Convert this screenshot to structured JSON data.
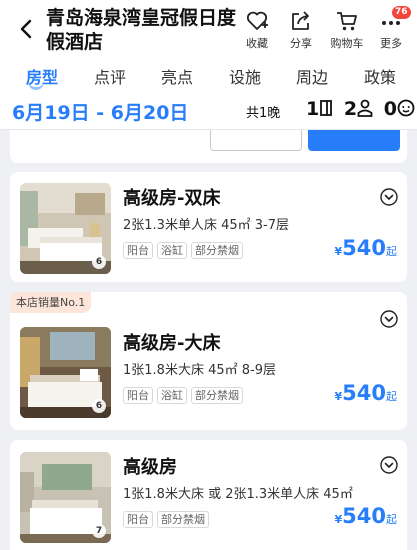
{
  "header": {
    "title": "青岛海泉湾皇冠假日度假酒店",
    "actions": [
      {
        "label": "收藏",
        "icon": "heart-plus-icon"
      },
      {
        "label": "分享",
        "icon": "share-icon"
      },
      {
        "label": "购物车",
        "icon": "cart-icon"
      },
      {
        "label": "更多",
        "icon": "more-icon",
        "badge": "76"
      }
    ]
  },
  "tabs": [
    "房型",
    "点评",
    "亮点",
    "设施",
    "周边",
    "政策"
  ],
  "active_tab": "房型",
  "datebar": {
    "dates": "6月19日 - 6月20日",
    "nights": "共1晚",
    "rooms": "1",
    "adults": "2",
    "children": "0"
  },
  "rooms": [
    {
      "name": "高级房-双床",
      "desc": "2张1.3米单人床  45㎡  3-7层",
      "tags": [
        "阳台",
        "浴缸",
        "部分禁烟"
      ],
      "currency": "¥",
      "price": "540",
      "price_suffix": "起",
      "photo_count": "6",
      "badge": ""
    },
    {
      "name": "高级房-大床",
      "desc": "1张1.8米大床  45㎡  8-9层",
      "tags": [
        "阳台",
        "浴缸",
        "部分禁烟"
      ],
      "currency": "¥",
      "price": "540",
      "price_suffix": "起",
      "photo_count": "6",
      "badge": "本店销量No.1"
    },
    {
      "name": "高级房",
      "desc": "1张1.8米大床 或 2张1.3米单人床  45㎡",
      "tags": [
        "阳台",
        "部分禁烟"
      ],
      "currency": "¥",
      "price": "540",
      "price_suffix": "起",
      "photo_count": "7",
      "badge": ""
    }
  ],
  "colors": {
    "accent": "#287dfa",
    "badge_red": "#f2463d",
    "bestseller_bg": "#fde6d9",
    "page_bg": "#eef0f4"
  }
}
